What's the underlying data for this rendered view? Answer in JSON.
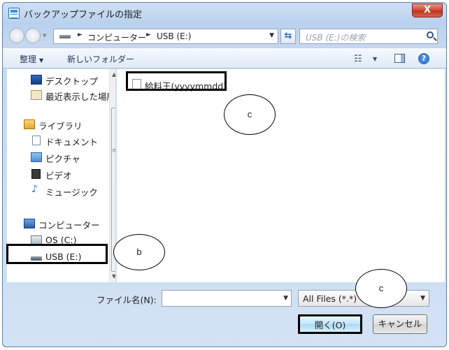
{
  "window": {
    "title": "バックアップファイルの指定",
    "close_glyph": "X"
  },
  "address": {
    "segments": [
      "コンピューター",
      "USB (E:)"
    ],
    "arrow": "►",
    "dropdown": "▼"
  },
  "search": {
    "placeholder": "USB (E:)の検索"
  },
  "toolbar": {
    "organize": "整理",
    "organize_caret": "▼",
    "new_folder": "新しいフォルダー",
    "views_glyph": "☷",
    "views_caret": "▼",
    "help_glyph": "?"
  },
  "navigation": {
    "items": [
      {
        "label": "デスクトップ",
        "icon": "desktop-icon"
      },
      {
        "label": "最近表示した場所",
        "icon": "recent-places-icon"
      },
      {
        "label": "ライブラリ",
        "icon": "library-icon"
      },
      {
        "label": "ドキュメント",
        "icon": "documents-icon"
      },
      {
        "label": "ピクチャ",
        "icon": "pictures-icon"
      },
      {
        "label": "ビデオ",
        "icon": "videos-icon"
      },
      {
        "label": "ミュージック",
        "icon": "music-icon"
      },
      {
        "label": "コンピューター",
        "icon": "computer-icon"
      },
      {
        "label": "OS (C:)",
        "icon": "os-drive-icon"
      },
      {
        "label": "USB (E:)",
        "icon": "usb-drive-icon"
      }
    ],
    "scroll_up": "▲",
    "scroll_down": "▼",
    "grip": "≡"
  },
  "files": [
    {
      "name": "給料王(yyyymmdd)",
      "icon": "file-icon"
    }
  ],
  "filename": {
    "label": "ファイル名(N):",
    "value": "",
    "caret": "▼"
  },
  "filter": {
    "selected": "All Files (*.*)",
    "caret": "▼"
  },
  "buttons": {
    "open": "開く(O)",
    "cancel": "キャンセル"
  },
  "annotations": {
    "bubble_top": "c",
    "bubble_left": "b",
    "bubble_bottom": "c"
  }
}
